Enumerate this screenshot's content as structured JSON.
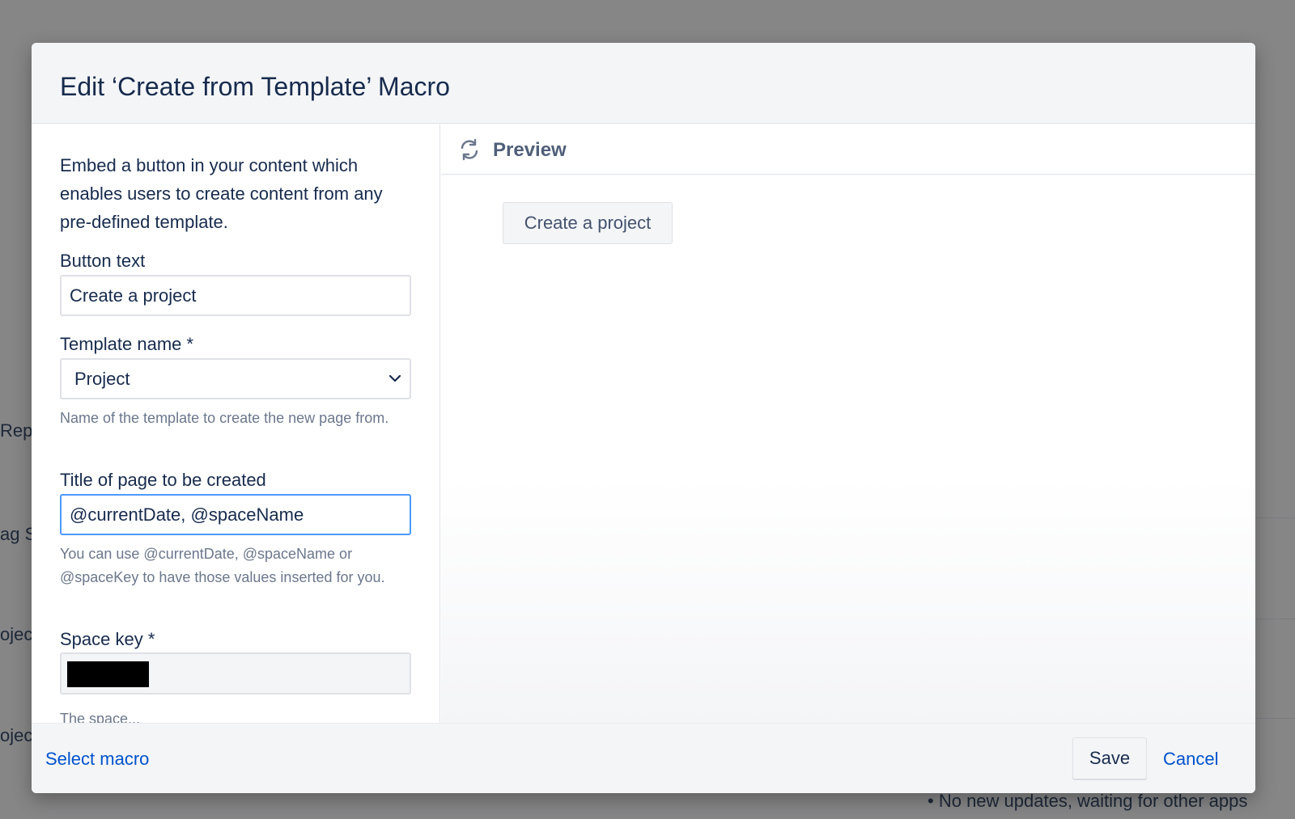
{
  "background_page": {
    "fragments": [
      "Rep",
      "ag S",
      "ojec",
      "ojec"
    ],
    "bottom_text": "No new updates, waiting for other apps"
  },
  "dialog": {
    "title": "Edit ‘Create from Template’ Macro",
    "description": "Embed a button in your content which enables users to create content from any pre-defined template.",
    "fields": {
      "button_text": {
        "label": "Button text",
        "value": "Create a project"
      },
      "template_name": {
        "label": "Template name *",
        "value": "Project",
        "help": "Name of the template to create the new page from."
      },
      "page_title": {
        "label": "Title of page to be created",
        "value": "@currentDate, @spaceName",
        "help": "You can use @currentDate, @spaceName or @spaceKey to have those values inserted for you."
      },
      "space_key": {
        "label": "Space key *",
        "value_redacted": true
      }
    },
    "preview": {
      "title": "Preview",
      "button_label": "Create a project"
    },
    "footer": {
      "select_macro": "Select macro",
      "save": "Save",
      "cancel": "Cancel"
    }
  },
  "colors": {
    "link": "#0052cc",
    "focus_border": "#4c9aff",
    "text": "#172b4d",
    "muted": "#6b778c",
    "panel_bg": "#f4f5f7"
  }
}
